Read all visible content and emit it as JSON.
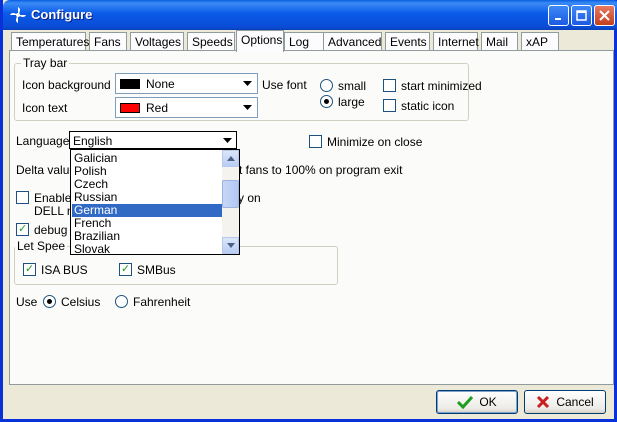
{
  "window": {
    "title": "Configure"
  },
  "tabs": [
    "Temperatures",
    "Fans",
    "Voltages",
    "Speeds",
    "Options",
    "Log",
    "Advanced",
    "Events",
    "Internet",
    "Mail",
    "xAP"
  ],
  "tray_bar": {
    "title": "Tray bar",
    "icon_background_label": "Icon background",
    "icon_background_value": "None",
    "icon_background_color": "#000000",
    "icon_text_label": "Icon text",
    "icon_text_value": "Red",
    "icon_text_color": "#FF0000",
    "use_font_label": "Use font",
    "small_label": "small",
    "large_label": "large",
    "start_minimized_label": "start minimized",
    "static_icon_label": "static icon"
  },
  "language": {
    "label": "Language",
    "value": "English",
    "options": [
      "Galician",
      "Polish",
      "Czech",
      "Russian",
      "German",
      "French",
      "Brazilian",
      "Slovak"
    ],
    "selected": "German"
  },
  "minimize_on_close_label": "Minimize on close",
  "delta_value_label": "Delta value",
  "fans_exit_label": "t fans to 100% on program exit",
  "enable_label": "Enable",
  "y_on_label": "y on",
  "dell_label": "DELL n",
  "debug_label": "debug",
  "let_speed": {
    "title": "Let Spee",
    "isa_bus_label": "ISA BUS",
    "smbus_label": "SMBus"
  },
  "units": {
    "use_label": "Use",
    "celsius_label": "Celsius",
    "fahrenheit_label": "Fahrenheit"
  },
  "buttons": {
    "ok": "OK",
    "cancel": "Cancel"
  }
}
